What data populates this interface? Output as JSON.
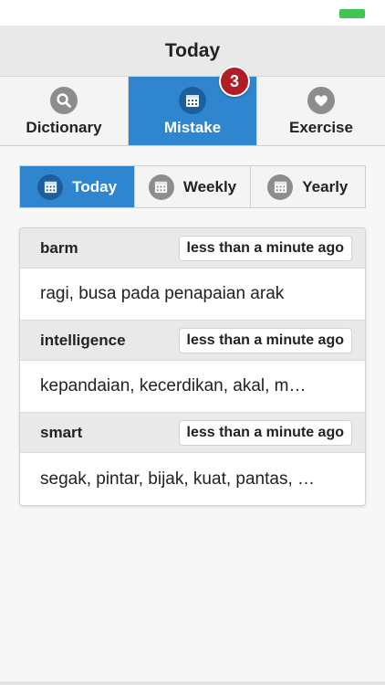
{
  "nav": {
    "title": "Today"
  },
  "tabs": [
    {
      "label": "Dictionary",
      "icon": "search-icon",
      "active": false
    },
    {
      "label": "Mistake",
      "icon": "calendar-icon",
      "active": true,
      "badge": "3"
    },
    {
      "label": "Exercise",
      "icon": "heart-icon",
      "active": false
    }
  ],
  "segments": [
    {
      "label": "Today",
      "icon": "calendar-icon",
      "active": true
    },
    {
      "label": "Weekly",
      "icon": "calendar-icon",
      "active": false
    },
    {
      "label": "Yearly",
      "icon": "calendar-icon",
      "active": false
    }
  ],
  "entries": [
    {
      "word": "barm",
      "time": "less than a minute ago",
      "meaning": "ragi, busa pada penapaian arak"
    },
    {
      "word": "intelligence",
      "time": "less than a minute ago",
      "meaning": "kepandaian, kecerdikan, akal, m…"
    },
    {
      "word": "smart",
      "time": "less than a minute ago",
      "meaning": "segak, pintar, bijak, kuat, pantas, …"
    }
  ],
  "colors": {
    "accent": "#2f86cf",
    "badge": "#b01d25",
    "battery": "#3ec552"
  }
}
